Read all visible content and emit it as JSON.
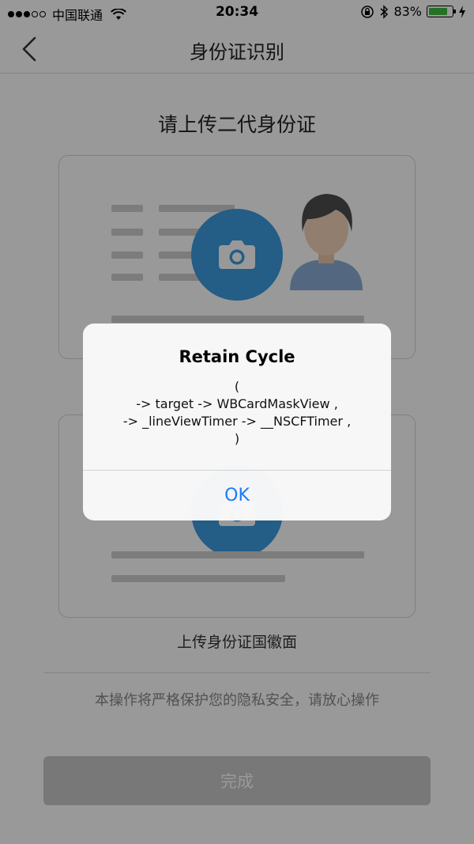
{
  "status_bar": {
    "carrier": "中国联通",
    "time": "20:34",
    "battery_percent": "83%",
    "battery_level": 0.83,
    "signal_bars": 3,
    "icons": [
      "wifi-icon",
      "orientation-lock-icon",
      "bluetooth-icon",
      "battery-icon",
      "charging-icon"
    ]
  },
  "nav": {
    "title": "身份证识别",
    "back_icon": "chevron-left-icon"
  },
  "main": {
    "headline": "请上传二代身份证",
    "card_back_caption": "上传身份证国徽面",
    "privacy_note": "本操作将严格保护您的隐私安全，请放心操作",
    "done_label": "完成",
    "camera_icon": "camera-icon",
    "avatar_icon": "person-avatar-icon"
  },
  "alert": {
    "title": "Retain Cycle",
    "message_lines": [
      "(",
      "-> target -> WBCardMaskView ,",
      "-> _lineViewTimer -> __NSCFTimer ,",
      ")"
    ],
    "ok_label": "OK"
  },
  "colors": {
    "accent_blue": "#3d9be0",
    "alert_button_blue": "#1a7cf5",
    "battery_green": "#3cbf3c",
    "done_button_gray": "#c8c8c8"
  }
}
